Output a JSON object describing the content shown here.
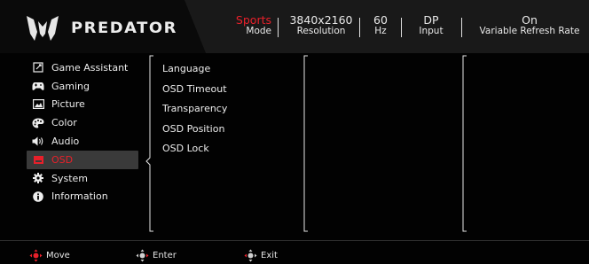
{
  "header": {
    "brand": "PREDATOR",
    "mode": {
      "value": "Sports",
      "label": "Mode"
    },
    "resolution": {
      "value": "3840x2160",
      "label": "Resolution"
    },
    "refresh": {
      "value": "60",
      "label": "Hz"
    },
    "input": {
      "value": "DP",
      "label": "Input"
    },
    "vrr": {
      "value": "On",
      "label": "Variable Refresh Rate"
    },
    "colors": {
      "accent": "#e8202a",
      "band": "#191919"
    }
  },
  "menu": {
    "items": [
      {
        "label": "Game Assistant",
        "icon": "game-assistant-icon"
      },
      {
        "label": "Gaming",
        "icon": "gamepad-icon"
      },
      {
        "label": "Picture",
        "icon": "picture-icon"
      },
      {
        "label": "Color",
        "icon": "palette-icon"
      },
      {
        "label": "Audio",
        "icon": "speaker-icon"
      },
      {
        "label": "OSD",
        "icon": "osd-icon",
        "active": true
      },
      {
        "label": "System",
        "icon": "gear-icon"
      },
      {
        "label": "Information",
        "icon": "info-icon"
      }
    ]
  },
  "submenu": {
    "items": [
      "Language",
      "OSD Timeout",
      "Transparency",
      "OSD Position",
      "OSD Lock"
    ]
  },
  "footer": {
    "move": "Move",
    "enter": "Enter",
    "exit": "Exit"
  }
}
